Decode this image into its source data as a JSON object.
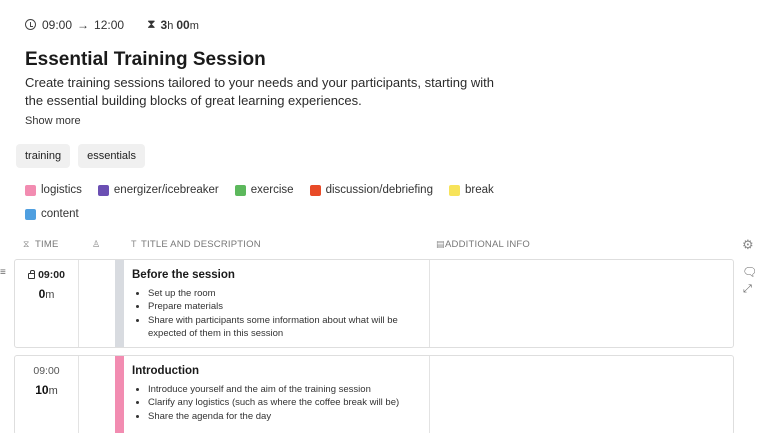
{
  "header": {
    "start_time": "09:00",
    "arrow": "→",
    "end_time": "12:00",
    "duration_hours": "3",
    "duration_h_unit": "h",
    "duration_minutes": "00",
    "duration_m_unit": "m"
  },
  "session": {
    "title": "Essential Training Session",
    "description": "Create training sessions tailored to your needs and your participants, starting with the essential building blocks of great learning experiences.",
    "show_more": "Show more"
  },
  "tags": [
    "training",
    "essentials"
  ],
  "legend": [
    {
      "label": "logistics",
      "color": "#f28cb1"
    },
    {
      "label": "energizer/icebreaker",
      "color": "#6b4fb3"
    },
    {
      "label": "exercise",
      "color": "#5cb85c"
    },
    {
      "label": "discussion/debriefing",
      "color": "#e84a27"
    },
    {
      "label": "break",
      "color": "#f7e35a"
    },
    {
      "label": "content",
      "color": "#4f9fe0"
    }
  ],
  "table": {
    "columns": {
      "time": "TIME",
      "title": "TITLE AND DESCRIPTION",
      "info": "ADDITIONAL INFO"
    },
    "rows": [
      {
        "start": "09:00",
        "duration_value": "0",
        "duration_unit": "m",
        "title": "Before the session",
        "items": [
          "Set up the room",
          "Prepare materials",
          "Share with participants some information about what will be expected of them in this session"
        ],
        "color": "#d8dbe0"
      },
      {
        "start": "09:00",
        "duration_value": "10",
        "duration_unit": "m",
        "title": "Introduction",
        "items": [
          "Introduce yourself and the aim of the training session",
          "Clarify any logistics (such as where the coffee break will be)",
          "Share the agenda for the day"
        ],
        "color": "#f28cb1"
      }
    ]
  },
  "icons": {
    "clock": "clock-icon",
    "hourglass": "hourglass-icon",
    "gear": "gear-icon",
    "comment": "comment-icon",
    "expand": "expand-icon",
    "lock": "lock-icon",
    "drag": "drag-handle-icon"
  }
}
